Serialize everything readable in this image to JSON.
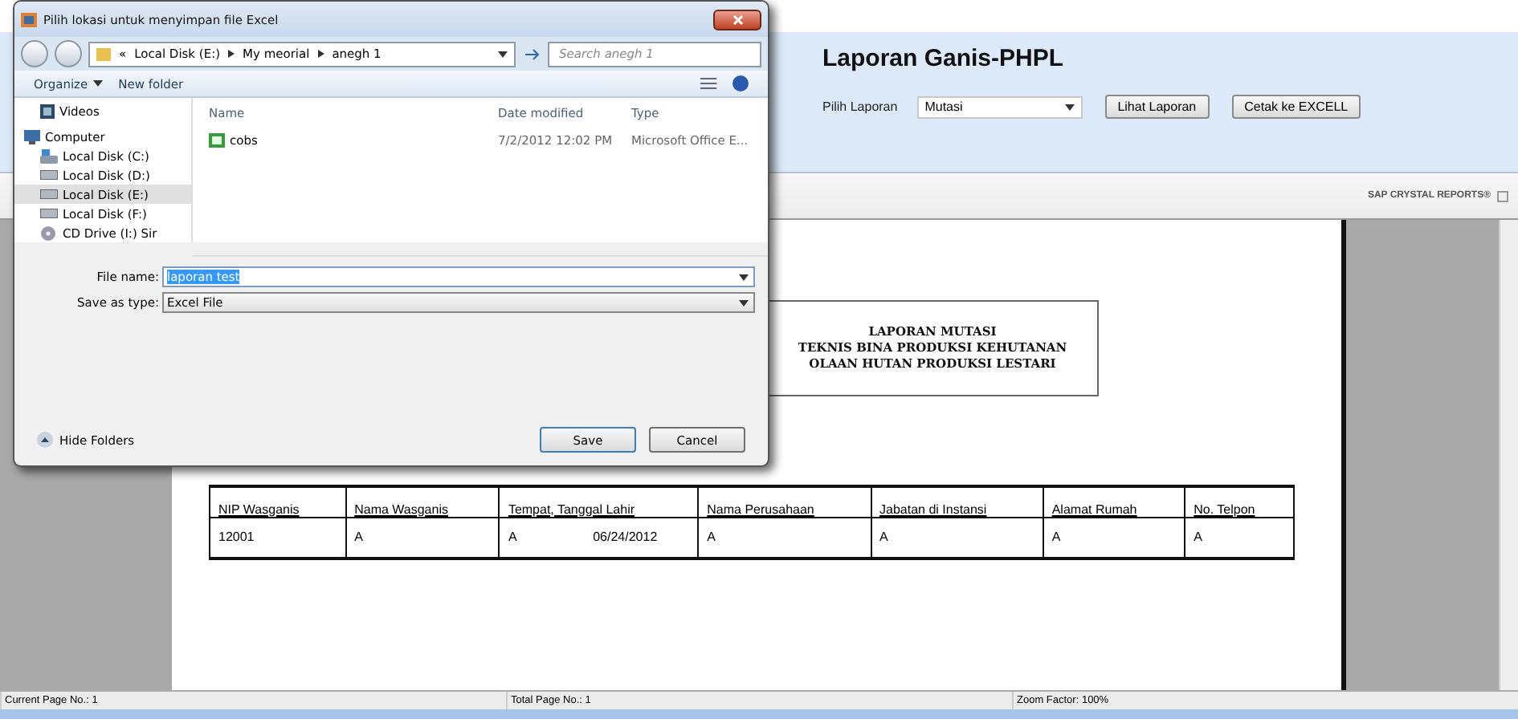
{
  "app": {
    "title": "Laporan Ganis-PHPL",
    "picker_label": "Pilih Laporan",
    "picker_value": "Mutasi",
    "buttons": [
      "Lihat Laporan",
      "Cetak ke EXCELL"
    ]
  },
  "viewer": {
    "brand": "SAP CRYSTAL REPORTS®",
    "report_heading": [
      "LAPORAN MUTASI",
      "TEKNIS BINA PRODUKSI KEHUTANAN",
      "OLAAN HUTAN PRODUKSI LESTARI"
    ],
    "table": {
      "columns": [
        "NIP Wasganis",
        "Nama Wasganis",
        "Tempat, Tanggal Lahir",
        "Nama Perusahaan",
        "Jabatan di Instansi",
        "Alamat Rumah",
        "No. Telpon"
      ],
      "rows": [
        [
          "12001",
          "A",
          {
            "place": "A",
            "date": "06/24/2012"
          },
          "A",
          "A",
          "A",
          "A"
        ]
      ]
    }
  },
  "status_bar": [
    "Current Page No.: 1",
    "Total Page No.: 1",
    "Zoom Factor: 100%"
  ],
  "dialog": {
    "title": "Pilih lokasi untuk menyimpan file Excel",
    "overflow": "«",
    "path": [
      "Local Disk (E:)",
      "My meorial",
      "anegh 1"
    ],
    "search_placeholder": "Search anegh 1",
    "toolbar": [
      "Organize",
      "New folder"
    ],
    "nav": [
      {
        "label": "Videos",
        "kind": "videos",
        "selected": false
      },
      {
        "label": "Computer",
        "kind": "computer",
        "selected": false
      },
      {
        "label": "Local Disk (C:)",
        "kind": "system",
        "selected": false
      },
      {
        "label": "Local Disk (D:)",
        "kind": "drive",
        "selected": false
      },
      {
        "label": "Local Disk (E:)",
        "kind": "drive",
        "selected": true
      },
      {
        "label": "Local Disk (F:)",
        "kind": "drive",
        "selected": false
      },
      {
        "label": "CD Drive (I:) Sir",
        "kind": "cd",
        "selected": false
      }
    ],
    "columns": [
      "Name",
      "Date modified",
      "Type"
    ],
    "files": [
      {
        "name": "cobs",
        "date": "7/2/2012 12:02 PM",
        "type": "Microsoft Office E..."
      }
    ],
    "file_name_label": "File name:",
    "file_name": "laporan test",
    "type_label": "Save as type:",
    "type_value": "Excel File",
    "hide_folders": "Hide Folders",
    "save": "Save",
    "cancel": "Cancel"
  }
}
